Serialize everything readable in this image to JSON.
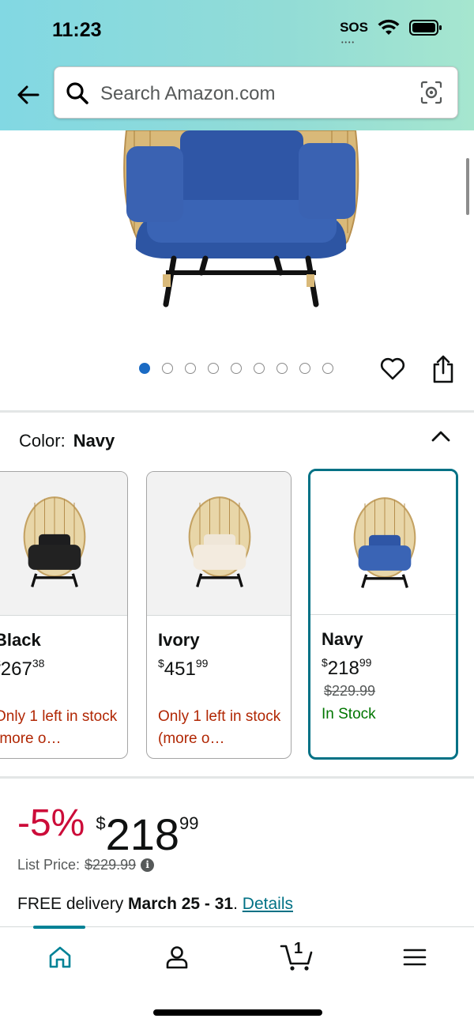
{
  "status_bar": {
    "time": "11:23",
    "sos": "SOS"
  },
  "search": {
    "placeholder": "Search Amazon.com"
  },
  "gallery": {
    "dot_count": 9,
    "active_index": 0
  },
  "color": {
    "label": "Color:",
    "selected": "Navy",
    "variants": [
      {
        "name": "Black",
        "price_symbol": "$",
        "price_whole": "267",
        "price_cents": "38",
        "list_price": "",
        "stock": "Only 1 left in stock (more o…"
      },
      {
        "name": "Ivory",
        "price_symbol": "$",
        "price_whole": "451",
        "price_cents": "99",
        "list_price": "",
        "stock": "Only 1 left in stock (more o…"
      },
      {
        "name": "Navy",
        "price_symbol": "$",
        "price_whole": "218",
        "price_cents": "99",
        "list_price": "$229.99",
        "stock": "In Stock"
      }
    ]
  },
  "price": {
    "discount": "-5%",
    "symbol": "$",
    "whole": "218",
    "cents": "99",
    "list_label": "List Price:",
    "list_value": "$229.99",
    "delivery_prefix": "FREE delivery ",
    "delivery_date": "March 25 - 31",
    "delivery_suffix": ". ",
    "details_link": "Details"
  },
  "nav": {
    "cart_count": "1"
  },
  "colors": {
    "accent": "#007185",
    "deal_red": "#cc0c39",
    "stock_red": "#b12704",
    "stock_green": "#007600",
    "header_start": "#82d8e3",
    "header_end": "#a6e6cf"
  }
}
